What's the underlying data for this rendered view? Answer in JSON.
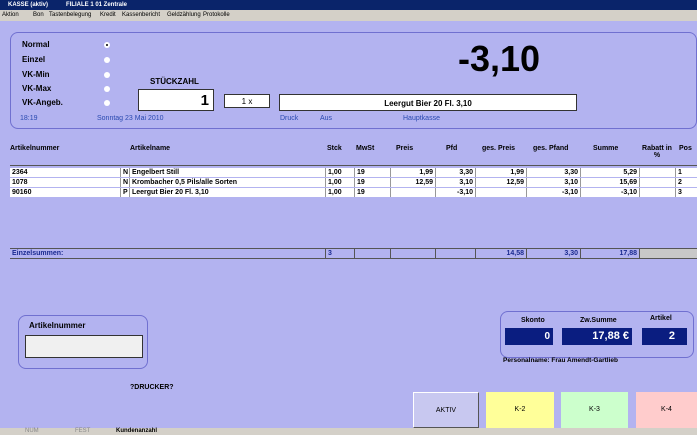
{
  "title": {
    "app": "KASSE (aktiv)",
    "branch": "FILIALE 1  01 Zentrale"
  },
  "menu": [
    "Aktion",
    "Bon",
    "Tastenbelegung",
    "Kredit",
    "Kassenbericht",
    "Geldzählung",
    "Protokolle"
  ],
  "modes": [
    {
      "label": "Normal",
      "selected": true
    },
    {
      "label": "Einzel",
      "selected": false
    },
    {
      "label": "VK-Min",
      "selected": false
    },
    {
      "label": "VK-Max",
      "selected": false
    },
    {
      "label": "VK-Angeb.",
      "selected": false
    }
  ],
  "stueckzahl_label": "STÜCKZAHL",
  "quantity": "1",
  "multiplier": "1 x",
  "item_display": "Leergut Bier 20 Fl.  3,10",
  "big_amount": "-3,10",
  "info": {
    "time": "18:19",
    "date": "Sonntag 23 Mai 2010",
    "druck": "Druck",
    "aus": "Aus",
    "kasse": "Hauptkasse"
  },
  "columns": [
    "Artikelnummer",
    "Artikelname",
    "Stck",
    "MwSt",
    "Preis",
    "Pfd",
    "ges. Preis",
    "ges. Pfand",
    "Summe",
    "Rabatt in %",
    "Pos"
  ],
  "rows": [
    {
      "nr": "2364",
      "flag": "N",
      "name": "Engelbert Still",
      "stck": "1,00",
      "mwst": "19",
      "preis": "1,99",
      "pfd": "3,30",
      "gpreis": "1,99",
      "gpfand": "3,30",
      "summe": "5,29",
      "rabatt": "",
      "pos": "1"
    },
    {
      "nr": "1078",
      "flag": "N",
      "name": "Krombacher  0,5 Pils/alle Sorten",
      "stck": "1,00",
      "mwst": "19",
      "preis": "12,59",
      "pfd": "3,10",
      "gpreis": "12,59",
      "gpfand": "3,10",
      "summe": "15,69",
      "rabatt": "",
      "pos": "2"
    },
    {
      "nr": "90160",
      "flag": "P",
      "name": "Leergut Bier 20 Fl.  3,10",
      "stck": "1,00",
      "mwst": "19",
      "preis": "",
      "pfd": "-3,10",
      "gpreis": "",
      "gpfand": "-3,10",
      "summe": "-3,10",
      "rabatt": "",
      "pos": "3"
    }
  ],
  "sums": {
    "label": "Einzelsummen:",
    "stck": "3",
    "gpreis": "14,58",
    "gpfand": "3,30",
    "summe": "17,88"
  },
  "artikel_label": "Artikelnummer",
  "artikel_value": "",
  "totals": {
    "skonto_label": "Skonto",
    "skonto": "0",
    "zwsumme_label": "Zw.Summe",
    "zwsumme": "17,88 €",
    "artikel_label": "Artikel",
    "artikel": "2"
  },
  "personal": "Personalname: Frau Amendt-Gartlieb",
  "drucker": "?DRUCKER?",
  "buttons": [
    {
      "label": "AKTIV",
      "color": "#c8c8f0"
    },
    {
      "label": "K-2",
      "color": "#ffff99"
    },
    {
      "label": "K-3",
      "color": "#ccffcc"
    },
    {
      "label": "K-4",
      "color": "#ffcccc"
    }
  ],
  "status": [
    "NUM",
    "FEST",
    "Kundenanzahl"
  ]
}
